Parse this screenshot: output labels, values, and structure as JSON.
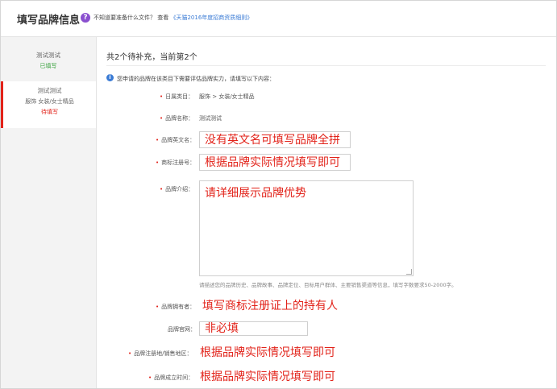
{
  "header": {
    "title": "填写品牌信息",
    "help_text": "不知道要准备什么文件？",
    "help_link_pre": "查看",
    "help_link": "《天猫2016年度招商资质细则》"
  },
  "sidebar": {
    "items": [
      {
        "name": "测试测试",
        "status": "已填写"
      },
      {
        "name": "测试测试",
        "category": "服饰 女装/女士精品",
        "status": "待填写"
      }
    ]
  },
  "main": {
    "progress": "共2个待补充，当前第2个",
    "info": "您申请的品牌在该类目下需要评估品牌实力，请填写以下内容：",
    "category": {
      "label": "日属类目：",
      "value": "服饰 > 女装/女士精品"
    },
    "brand_name": {
      "label": "品牌名称：",
      "value": "测试测试"
    },
    "english_name": {
      "label": "品牌英文名：",
      "hint": "没有英文名可填写品牌全拼"
    },
    "trademark_no": {
      "label": "商标注册号：",
      "hint": "根据品牌实际情况填写即可"
    },
    "intro": {
      "label": "品牌介绍：",
      "hint": "请详细展示品牌优势",
      "note": "请描述您的品牌历史、品牌故事、品牌定位、目标用户群体、主要销售渠道等信息，填写字数要求50-2000字。"
    },
    "owner": {
      "label": "品牌拥有者：",
      "hint": "填写商标注册证上的持有人"
    },
    "website": {
      "label": "品牌官网：",
      "hint": "非必填"
    },
    "region": {
      "label": "品牌注册地/销售地区：",
      "hint": "根据品牌实际情况填写即可"
    },
    "founded": {
      "label": "品牌成立时间：",
      "hint": "根据品牌实际情况填写即可"
    }
  },
  "colors": {
    "accent": "#e2231a",
    "link": "#3a7bd5",
    "done": "#36a03a"
  }
}
